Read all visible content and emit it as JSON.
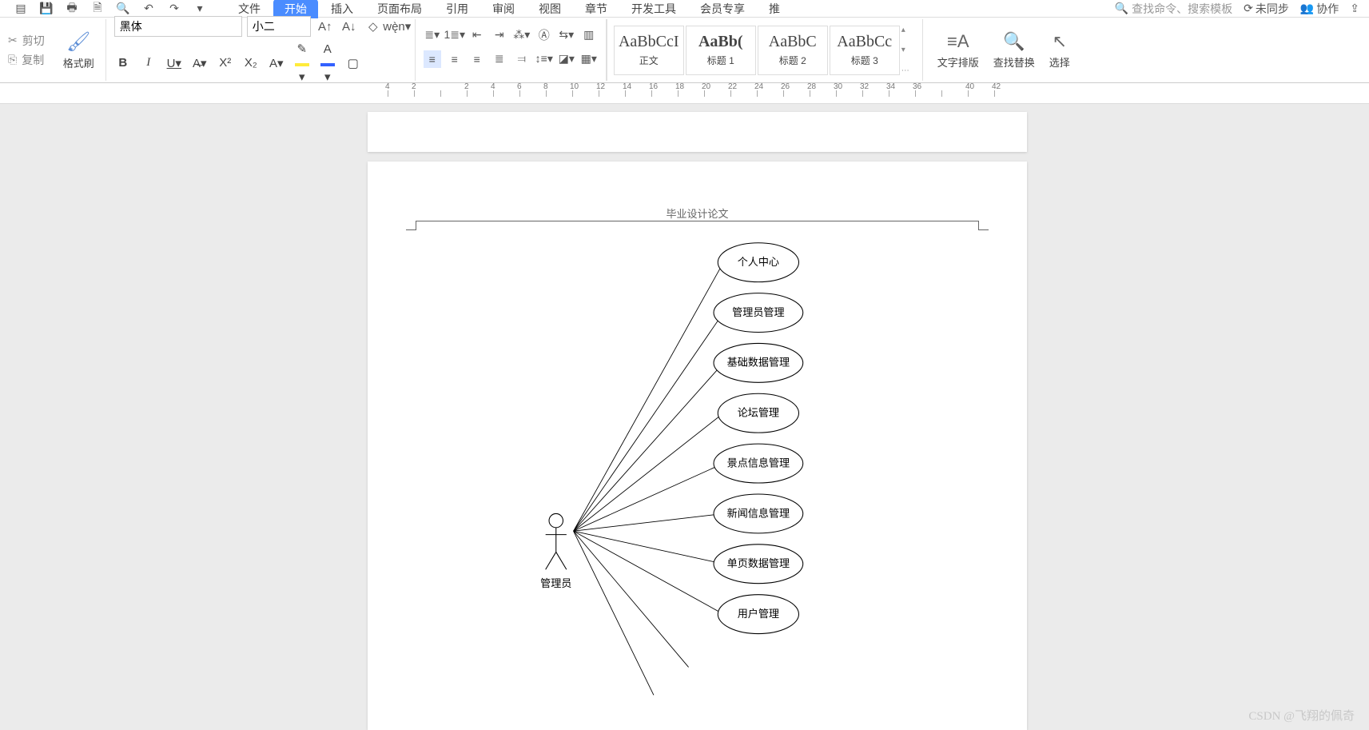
{
  "top": {
    "tabs": [
      "文件",
      "开始",
      "插入",
      "页面布局",
      "引用",
      "审阅",
      "视图",
      "章节",
      "开发工具",
      "会员专享",
      "推"
    ],
    "active_index": 1,
    "search_placeholder": "查找命令、搜索模板",
    "right_links": [
      "未同步",
      "协作"
    ]
  },
  "ribbon": {
    "cut": "剪切",
    "copy": "复制",
    "format_brush": "格式刷",
    "font_name": "黑体",
    "font_size": "小二",
    "styles": [
      {
        "preview": "AaBbCcI",
        "name": "正文"
      },
      {
        "preview": "AaBb(",
        "name": "标题 1"
      },
      {
        "preview": "AaBbC",
        "name": "标题 2"
      },
      {
        "preview": "AaBbCc",
        "name": "标题 3"
      }
    ],
    "text_layout": "文字排版",
    "find_replace": "查找替换",
    "select": "选择"
  },
  "ruler_values": [
    "4",
    "2",
    "",
    "2",
    "4",
    "6",
    "8",
    "10",
    "12",
    "14",
    "16",
    "18",
    "20",
    "22",
    "24",
    "26",
    "28",
    "30",
    "32",
    "34",
    "36",
    "",
    "40",
    "42"
  ],
  "document": {
    "header_title": "毕业设计论文",
    "actor_label": "管理员",
    "use_cases": [
      "个人中心",
      "管理员管理",
      "基础数据管理",
      "论坛管理",
      "景点信息管理",
      "新闻信息管理",
      "单页数据管理",
      "用户管理"
    ]
  },
  "watermark": "CSDN @飞翔的佩奇"
}
